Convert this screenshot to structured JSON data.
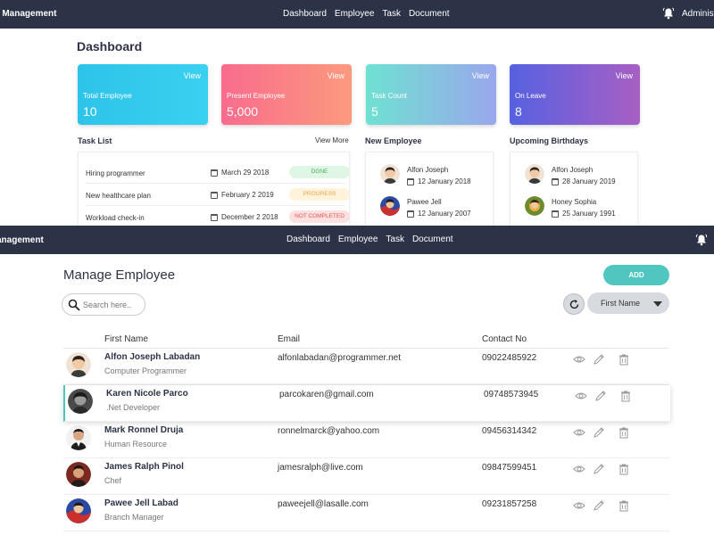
{
  "top": {
    "nav": {
      "brand": "e Management",
      "links": [
        "Dashboard",
        "Employee",
        "Task",
        "Document"
      ],
      "user": "Administ"
    },
    "title": "Dashboard",
    "cards": [
      {
        "label": "Total Employee",
        "value": "10",
        "view": "View"
      },
      {
        "label": "Present Employee",
        "value": "5,000",
        "view": "View"
      },
      {
        "label": "Task Count",
        "value": "5",
        "view": "View"
      },
      {
        "label": "On Leave",
        "value": "8",
        "view": "View"
      }
    ],
    "task_list": {
      "title": "Task List",
      "view_more": "View More",
      "items": [
        {
          "name": "Hiring programmer",
          "date": "March 29 2018",
          "status": "DONE"
        },
        {
          "name": "New healthcare plan",
          "date": "February 2 2019",
          "status": "PROGRESS"
        },
        {
          "name": "Workload check-in",
          "date": "December 2 2018",
          "status": "NOT COMPLETED"
        }
      ]
    },
    "new_employee": {
      "title": "New Employee",
      "items": [
        {
          "name": "Alfon Joseph",
          "date": "12 January 2018"
        },
        {
          "name": "Pawee Jell",
          "date": "12 January 2007"
        }
      ]
    },
    "birthdays": {
      "title": "Upcoming Birthdays",
      "items": [
        {
          "name": "Alfon Joseph",
          "date": "28 January 2019"
        },
        {
          "name": "Honey Sophia",
          "date": "25 January 1991"
        }
      ]
    }
  },
  "bottom": {
    "nav": {
      "brand": "anagement",
      "links": [
        "Dashboard",
        "Employee",
        "Task",
        "Document"
      ]
    },
    "title": "Manage Employee",
    "add_label": "ADD",
    "search_placeholder": "Search here..",
    "sort_select": "First Name",
    "columns": [
      "First Name",
      "Email",
      "Contact No"
    ],
    "employees": [
      {
        "name": "Alfon Joseph Labadan",
        "role": "Computer Programmer",
        "email": "alfonlabadan@programmer.net",
        "phone": "09022485922"
      },
      {
        "name": "Karen Nicole Parco",
        "role": ".Net Developer",
        "email": "parcokaren@gmail.com",
        "phone": "09748573945"
      },
      {
        "name": "Mark Ronnel Druja",
        "role": "Human Resource",
        "email": "ronnelmarck@yahoo.com",
        "phone": "09456314342"
      },
      {
        "name": "James Ralph Pinol",
        "role": "Chef",
        "email": "jamesralph@live.com",
        "phone": "09847599451"
      },
      {
        "name": "Pawee Jell Labad",
        "role": "Branch Manager",
        "email": "paweejell@lasalle.com",
        "phone": "09231857258"
      }
    ]
  },
  "colors": {
    "nav_bg": "#2c3347",
    "accent": "#4fc7c0",
    "done": "#45b35a",
    "progress": "#e8a54a",
    "not_completed": "#e25555"
  },
  "icons": [
    "bell-icon",
    "calendar-icon",
    "search-icon",
    "refresh-icon",
    "caret-down-icon",
    "eye-icon",
    "pencil-icon",
    "trash-icon"
  ]
}
